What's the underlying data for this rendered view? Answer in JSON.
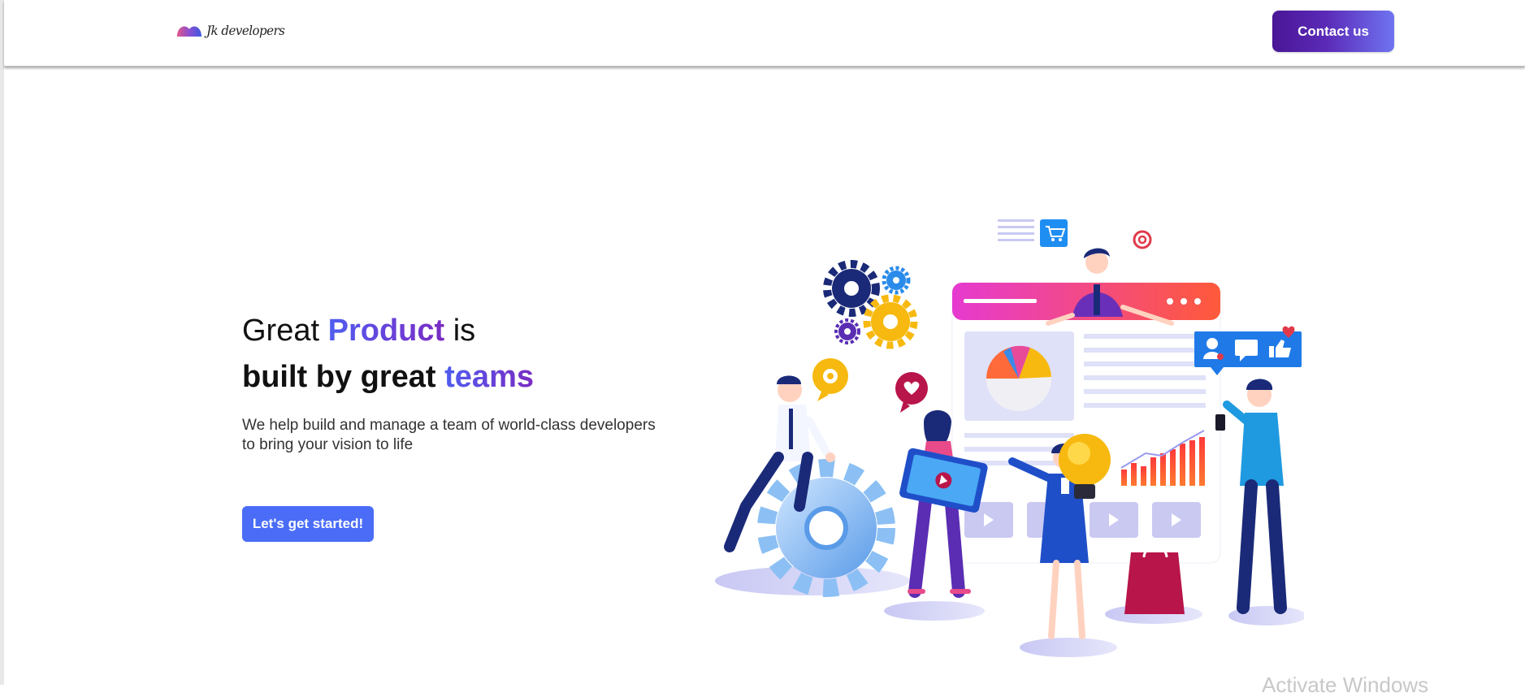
{
  "header": {
    "logo_text": "Jk developers",
    "contact_label": "Contact us"
  },
  "hero": {
    "title_line1_pre": "Great ",
    "title_line1_accent": "Product",
    "title_line1_post": " is",
    "title_line2_pre": "built by great ",
    "title_line2_accent": "teams",
    "subtitle_line1": "We help build and manage a team of world-class developers",
    "subtitle_line2": "to bring your vision to life",
    "cta_label": "Let's get started!"
  },
  "watermark": {
    "text": "Activate Windows"
  },
  "colors": {
    "accent_blue": "#4a6cf7",
    "accent_purple": "#7a2bc2",
    "contact_gradient_start": "#4a1697",
    "contact_gradient_end": "#6f74f0"
  },
  "icons": [
    "logo-mark-icon",
    "gear-icon",
    "cart-icon",
    "at-sign-icon",
    "heart-icon",
    "pie-chart-icon",
    "bar-chart-icon",
    "lightbulb-icon",
    "play-icon",
    "user-icon",
    "chat-icon",
    "thumbs-up-icon",
    "shopping-bag-icon"
  ]
}
